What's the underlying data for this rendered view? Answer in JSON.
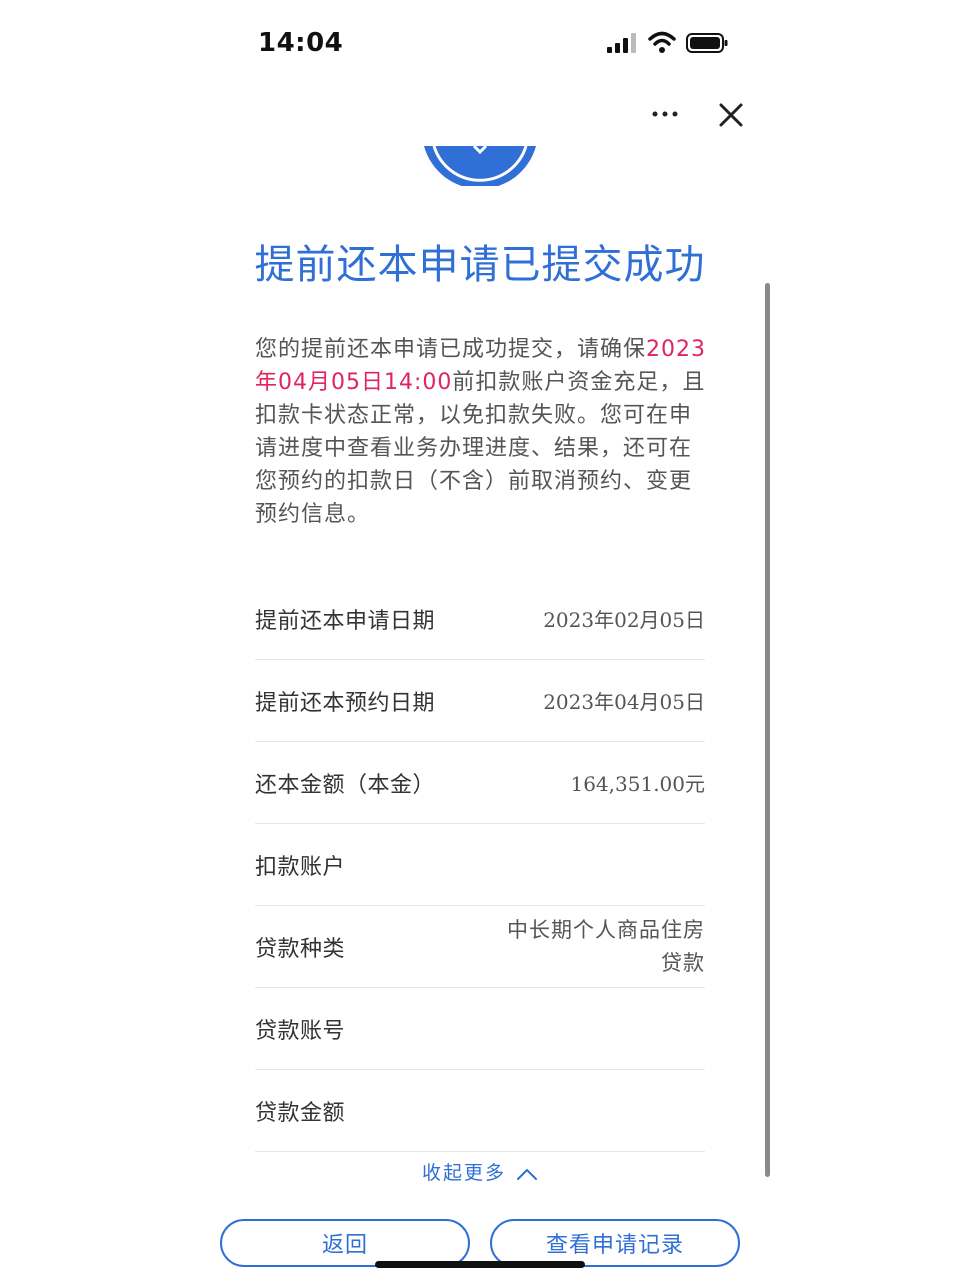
{
  "status_bar": {
    "time": "14:04"
  },
  "title": "提前还本申请已提交成功",
  "message": {
    "part1": "您的提前还本申请已成功提交，请确保",
    "highlight": "2023年04月05日14:00",
    "part2": "前扣款账户资金充足，且扣款卡状态正常，以免扣款失败。您可在申请进度中查看业务办理进度、结果，还可在您预约的扣款日（不含）前取消预约、变更预约信息。"
  },
  "details": [
    {
      "label": "提前还本申请日期",
      "value": "2023年02月05日"
    },
    {
      "label": "提前还本预约日期",
      "value": "2023年04月05日"
    },
    {
      "label": "还本金额（本金）",
      "value": "164,351.00元"
    },
    {
      "label": "扣款账户",
      "value": ""
    },
    {
      "label": "贷款种类",
      "value": "中长期个人商品住房贷款"
    },
    {
      "label": "贷款账号",
      "value": ""
    },
    {
      "label": "贷款金额",
      "value": ""
    }
  ],
  "collapse_label": "收起更多",
  "buttons": {
    "back": "返回",
    "records": "查看申请记录"
  },
  "colors": {
    "accent": "#2f6fd6",
    "highlight": "#e0245e"
  },
  "icons": [
    "more-icon",
    "close-icon",
    "success-check-icon",
    "chevron-up-icon"
  ]
}
